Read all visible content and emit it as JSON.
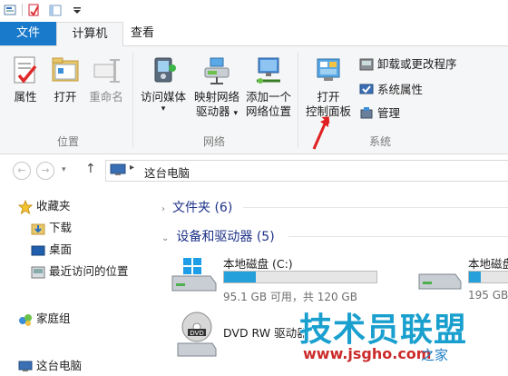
{
  "ribbon_tabs": {
    "file": "文件",
    "computer": "计算机",
    "view": "查看"
  },
  "location_group": {
    "label": "位置",
    "properties": "属性",
    "open": "打开",
    "rename": "重命名"
  },
  "network_group": {
    "label": "网络",
    "access_media": "访问媒体",
    "map_drive_1": "映射网络",
    "map_drive_2": "驱动器",
    "add_location_1": "添加一个",
    "add_location_2": "网络位置"
  },
  "system_group": {
    "label": "系统",
    "open_cp_1": "打开",
    "open_cp_2": "控制面板",
    "uninstall": "卸载或更改程序",
    "system_properties": "系统属性",
    "manage": "管理"
  },
  "address_bar": {
    "path": "这台电脑"
  },
  "nav_pane": {
    "favorites": "收藏夹",
    "downloads": "下载",
    "desktop": "桌面",
    "recent": "最近访问的位置",
    "homegroup": "家庭组",
    "this_pc": "这台电脑"
  },
  "content": {
    "folders_header": "文件夹 (6)",
    "devices_header": "设备和驱动器 (5)",
    "drive_c": {
      "name": "本地磁盘 (C:)",
      "info": "95.1 GB 可用，共 120 GB",
      "used_fraction": 0.21
    },
    "drive_d": {
      "name": "本地磁盘",
      "info": "195 GB",
      "used_fraction": 0.3
    },
    "dvd": {
      "name": "DVD RW 驱动器"
    }
  },
  "watermark": {
    "brand": "技术员联盟",
    "url": "www.jsgho.com",
    "suffix": "之家"
  },
  "colors": {
    "accent": "#1979ca",
    "progress": "#26a0da",
    "annotation": "#e02020"
  }
}
